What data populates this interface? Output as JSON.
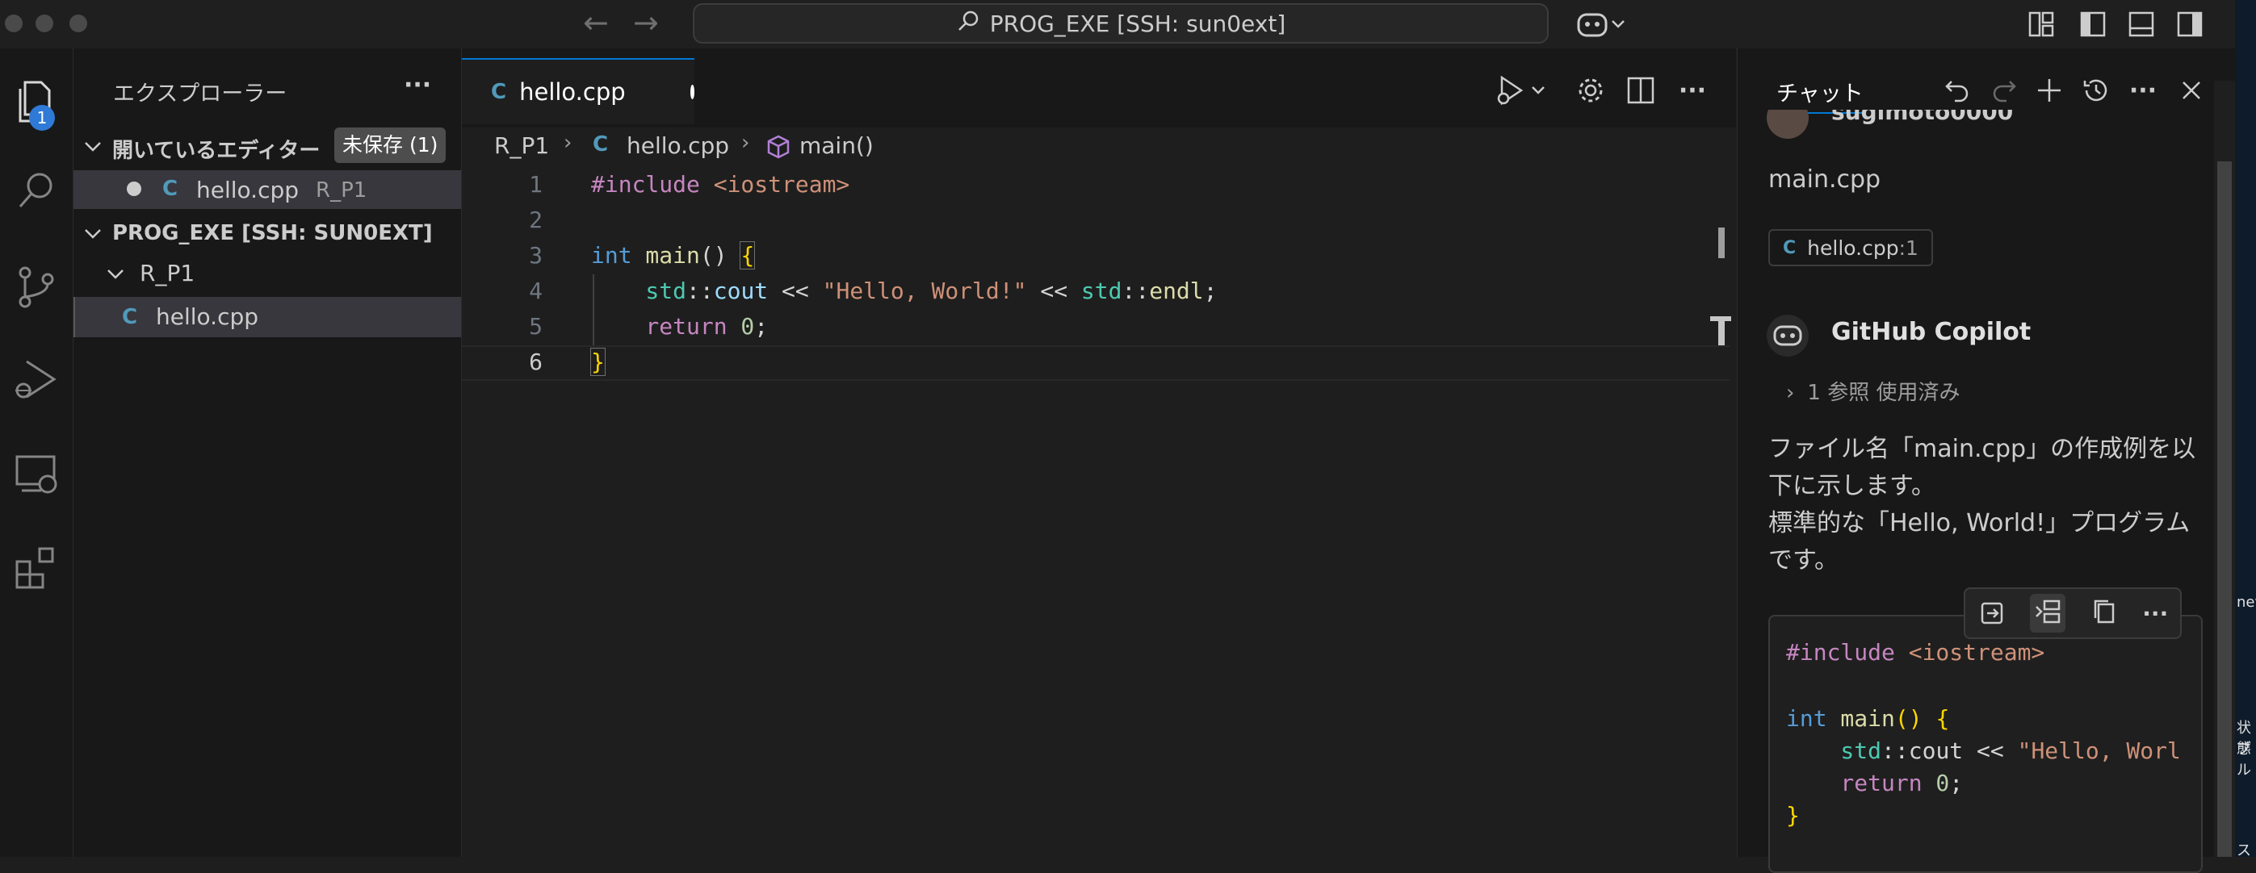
{
  "titlebar": {
    "search_text": "PROG_EXE [SSH: sun0ext]"
  },
  "activity": {
    "explorer_badge": "1"
  },
  "sidebar": {
    "title": "エクスプローラー",
    "more": "···",
    "open_editors_label": "開いているエディター",
    "unsaved_badge": "未保存 (1)",
    "open_file_name": "hello.cpp",
    "open_file_folder": "R_P1",
    "workspace_label": "PROG_EXE [SSH: SUN0EXT]",
    "folder_name": "R_P1",
    "file_name": "hello.cpp"
  },
  "editor": {
    "tab_label": "hello.cpp",
    "breadcrumb": {
      "folder": "R_P1",
      "file": "hello.cpp",
      "symbol": "main()"
    },
    "line_numbers": [
      "1",
      "2",
      "3",
      "4",
      "5",
      "6"
    ],
    "code": {
      "l1_directive": "#include",
      "l1_header": " <iostream>",
      "l3_type": "int",
      "l3_func": " main",
      "l3_parens": "() ",
      "l3_brace": "{",
      "l4_ns": "    std",
      "l4_sep": "::",
      "l4_cout": "cout",
      "l4_op": " << ",
      "l4_str": "\"Hello, World!\"",
      "l4_op2": " << ",
      "l4_ns2": "std",
      "l4_sep2": "::",
      "l4_endl": "endl",
      "l4_semi": ";",
      "l5_return": "    return",
      "l5_num": " 0",
      "l5_semi": ";",
      "l6_brace": "}"
    }
  },
  "chat": {
    "tab_label": "チャット",
    "user_name": "sugimoto0000",
    "user_message": "main.cpp",
    "reference_chip": "hello.cpp",
    "reference_line": ":1",
    "assistant_name": "GitHub Copilot",
    "references_used": "1 参照 使用済み",
    "response_line1": "ファイル名「main.cpp」の作成例を以",
    "response_line2": "下に示します。",
    "response_line3": "標準的な「Hello, World!」プログラム",
    "response_line4": "です。",
    "code": {
      "l1_directive": "#include",
      "l1_header": " <iostream>",
      "l3_type": "int",
      "l3_func": " main",
      "l3_rest": "() {",
      "l4_ns": "    std",
      "l4_rest": "::cout << ",
      "l4_str": "\"Hello, Worl",
      "l5_return": "    return",
      "l5_num": " 0",
      "l5_semi": ";",
      "l6_brace": "}"
    }
  },
  "desktop_fragments": [
    "new",
    "状態",
    "ブル",
    "ス"
  ],
  "colors": {
    "accent": "#0078d4",
    "badge": "#2f7ad6",
    "cpp_icon": "#519aba"
  }
}
